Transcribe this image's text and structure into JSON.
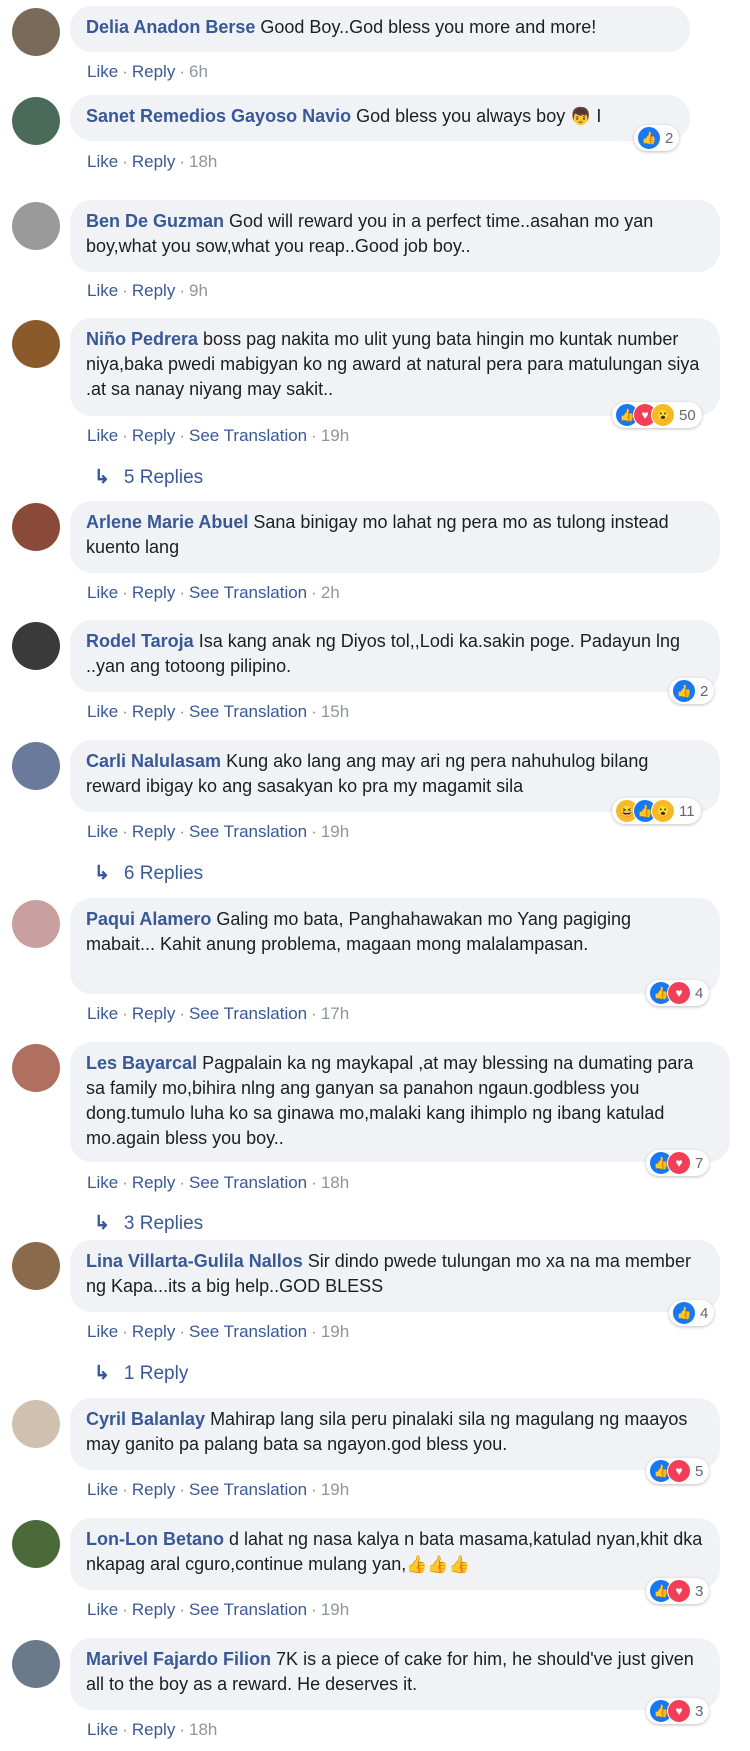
{
  "actions": {
    "like": "Like",
    "reply": "Reply",
    "see_translation": "See Translation"
  },
  "comments": [
    {
      "name": "Delia Anadon Berse",
      "text": "Good Boy..God bless you more and more!",
      "time": "6h",
      "avatar_color": "#7a6a5a"
    },
    {
      "name": "Sanet Remedios Gayoso Navio",
      "text": "God bless you always boy",
      "emoji": "👦",
      "trail": "I",
      "time": "18h",
      "reactions": [
        "like"
      ],
      "count": "2",
      "avatar_color": "#4a6a5a"
    },
    {
      "name": "Ben De Guzman",
      "text": "God will reward you in a perfect time..asahan mo yan boy,what you sow,what you reap..Good job boy..",
      "time": "9h",
      "avatar_color": "#9a9a9a"
    },
    {
      "name": "Niño Pedrera",
      "text": "boss pag nakita mo ulit yung bata hingin mo kuntak number niya,baka pwedi mabigyan ko ng award at natural pera para matulungan siya .at sa nanay niyang may sakit..",
      "time": "19h",
      "reactions": [
        "like",
        "love",
        "wow"
      ],
      "count": "50",
      "replies": "5 Replies",
      "avatar_color": "#8a5a2a"
    },
    {
      "name": "Arlene Marie Abuel",
      "text": "Sana binigay mo lahat ng pera mo as tulong instead kuento lang",
      "time": "2h",
      "avatar_color": "#8a4a3a"
    },
    {
      "name": "Rodel Taroja",
      "text": "Isa kang anak ng Diyos tol,,Lodi ka.sakin poge. Padayun lng ..yan ang totoong pilipino.",
      "time": "15h",
      "reactions": [
        "like"
      ],
      "count": "2",
      "avatar_color": "#3a3a3a"
    },
    {
      "name": "Carli Nalulasam",
      "text": "Kung ako lang ang may ari ng pera nahuhulog bilang reward ibigay ko ang sasakyan ko pra my magamit sila",
      "time": "19h",
      "reactions": [
        "haha",
        "like",
        "wow"
      ],
      "count": "11",
      "replies": "6 Replies",
      "avatar_color": "#6a7a9a"
    },
    {
      "name": "Paqui Alamero",
      "text": "Galing mo bata, Panghahawakan mo Yang pagiging mabait... Kahit anung problema, magaan mong malalampasan.",
      "time": "17h",
      "reactions": [
        "like",
        "love"
      ],
      "count": "4",
      "avatar_color": "#c9a0a0"
    },
    {
      "name": "Les Bayarcal",
      "text": "Pagpalain ka ng maykapal ,at may blessing na dumating para sa family mo,bihira nlng ang ganyan sa panahon ngaun.godbless you dong.tumulo luha ko sa ginawa mo,malaki kang ihimplo ng ibang katulad mo.again bless you boy..",
      "time": "18h",
      "reactions": [
        "like",
        "love"
      ],
      "count": "7",
      "replies": "3 Replies",
      "avatar_color": "#b07060"
    },
    {
      "name": "Lina Villarta-Gulila Nallos",
      "text": "Sir dindo pwede tulungan mo xa na ma member ng Kapa...its a big help..GOD BLESS",
      "time": "19h",
      "reactions": [
        "like"
      ],
      "count": "4",
      "replies": "1 Reply",
      "avatar_color": "#8a6a4a"
    },
    {
      "name": "Cyril Balanlay",
      "text": "Mahirap lang sila peru pinalaki sila ng magulang ng maayos may ganito pa palang bata sa ngayon.god bless you.",
      "time": "19h",
      "reactions": [
        "like",
        "love"
      ],
      "count": "5",
      "avatar_color": "#d0c0b0"
    },
    {
      "name": "Lon-Lon Betano",
      "text": "d lahat ng nasa kalya n bata masama,katulad nyan,khit dka nkapag aral cguro,continue mulang yan,",
      "emoji": "👍👍👍",
      "time": "19h",
      "reactions": [
        "like",
        "love"
      ],
      "count": "3",
      "avatar_color": "#4a6a3a"
    },
    {
      "name": "Marivel Fajardo Filion",
      "text": "7K is a piece of cake for him, he should've just given all to the boy as a reward. He deserves it.",
      "time": "18h",
      "reactions": [
        "like",
        "love"
      ],
      "count": "3",
      "avatar_color": "#6a7a8a"
    }
  ],
  "icons": {
    "like": "thumbs-up-icon",
    "love": "heart-icon",
    "wow": "wow-face-icon",
    "haha": "laugh-face-icon",
    "reply_arrow": "reply-arrow-icon"
  },
  "colors": {
    "name": "#385898",
    "bubble": "#f0f2f5",
    "like": "#1877f2",
    "love": "#f33e58",
    "wow": "#f7b928"
  }
}
